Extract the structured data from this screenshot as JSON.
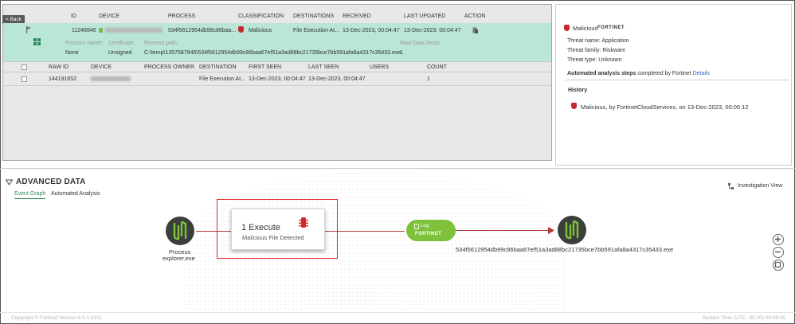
{
  "back_button": "< Back",
  "table": {
    "headers": [
      "ID",
      "DEVICE",
      "PROCESS",
      "CLASSIFICATION",
      "DESTINATIONS",
      "RECEIVED",
      "LAST UPDATED",
      "ACTION"
    ],
    "row": {
      "id": "11248846",
      "process": "534f5612954db99c86baa...",
      "classification": "Malicious",
      "destinations": "File Execution At...",
      "received": "13-Dec-2023, 00:04:47",
      "last_updated": "13-Dec-2023, 00:04:47"
    },
    "details": {
      "process_owner_label": "Process owner:",
      "process_owner": "None",
      "certificate_label": "Certificate:",
      "certificate": "Unsigned",
      "process_path_label": "Process path:",
      "process_path": "C:\\temp\\1357587845\\534f5612954db99c86baa67ef51a3ad88bc21735bce7bb591afa8a4317c35433.exe",
      "raw_items_label": "Raw Data Items:",
      "raw_items": "1"
    },
    "sub_headers": [
      "RAW ID",
      "DEVICE",
      "PROCESS OWNER",
      "DESTINATION",
      "FIRST SEEN",
      "LAST SEEN",
      "USERS",
      "COUNT"
    ],
    "sub_row": {
      "raw_id": "144191652",
      "destination": "File Execution At...",
      "first_seen": "13-Dec-2023, 00:04:47",
      "last_seen": "13-Dec-2023, 00:04:47",
      "count": "1"
    }
  },
  "right_panel": {
    "verdict": "Malicious",
    "brand": "FORTINET",
    "threat_name": "Threat name: Application",
    "threat_family": "Threat family: Riskware",
    "threat_type": "Threat type: Unknown",
    "auto_steps_bold": "Automated analysis steps",
    "auto_steps_rest": " completed by Fortinet ",
    "details_link": "Details",
    "history_title": "History",
    "history_item": "Malicious, by FortinetCloudServices, on 13-Dec-2023, 00:05:12"
  },
  "advanced": {
    "title": "ADVANCED DATA",
    "tabs": [
      "Event Graph",
      "Automated Analysis"
    ],
    "investigation_view": "Investigation View"
  },
  "graph": {
    "process_node": [
      "Process",
      "explorer.exe"
    ],
    "card_title": "1 Execute",
    "card_subtitle": "Malicious File Detected",
    "log_label": "Log",
    "log_brand": "FORTINET",
    "target_node": "534f5612954db99c86baa67ef51a3ad88bc21735bce7bb591afa8a4317c35433.exe"
  },
  "footer": {
    "copyright": "Copyright © Fortinet Version 6.0.1.0151",
    "time": "System Time (UTC -05:00) 00:48:05"
  },
  "colors": {
    "selected_row": "#b9e6d6",
    "accent_green": "#2f8c5d",
    "malicious_red": "#c8282e",
    "log_green": "#7ec13a",
    "highlight_red": "#e0292d"
  }
}
